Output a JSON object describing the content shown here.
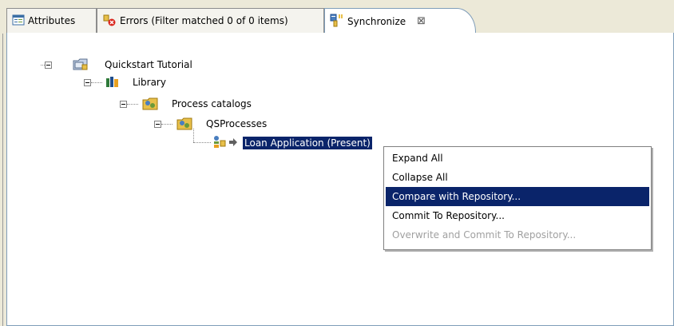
{
  "tabs": [
    {
      "label": "Attributes",
      "icon": "attributes-icon"
    },
    {
      "label": "Errors (Filter matched 0 of 0 items)",
      "icon": "errors-icon"
    },
    {
      "label": "Synchronize",
      "icon": "synchronize-icon",
      "close": "⊠"
    }
  ],
  "tree": {
    "root": {
      "label": "Quickstart Tutorial"
    },
    "library": {
      "label": "Library"
    },
    "catalogs": {
      "label": "Process catalogs"
    },
    "qsprocesses": {
      "label": "QSProcesses"
    },
    "loan": {
      "label": "Loan Application (Present)"
    }
  },
  "context_menu": {
    "items": [
      {
        "label": "Expand All"
      },
      {
        "label": "Collapse All"
      },
      {
        "label": "Compare with Repository..."
      },
      {
        "label": "Commit To Repository..."
      },
      {
        "label": "Overwrite and Commit To Repository..."
      }
    ]
  },
  "colors": {
    "selection": "#0a246a",
    "background": "#ece9d8",
    "border": "#7f9db9"
  }
}
